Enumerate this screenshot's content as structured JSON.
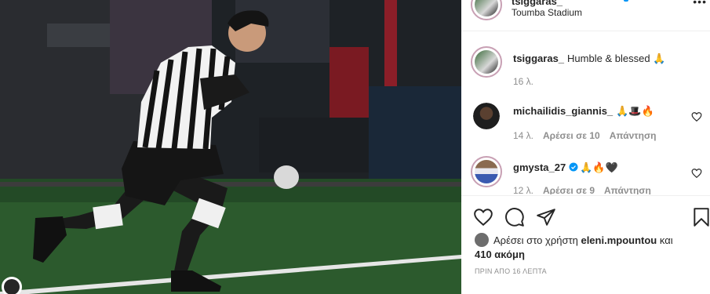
{
  "post_header": {
    "username": "tsiggaras_",
    "location": "Toumba Stadium",
    "more_label": "•••"
  },
  "comments": [
    {
      "username": "tsiggaras_",
      "text": "Humble & blessed 🙏",
      "time": "16 λ.",
      "likes": "",
      "reply": ""
    },
    {
      "username": "michailidis_giannis_",
      "text": "🙏🎩🔥",
      "time": "14 λ.",
      "likes": "Αρέσει σε 10",
      "reply": "Απάντηση"
    },
    {
      "username": "gmysta_27",
      "text": "🙏🔥🖤",
      "time": "12 λ.",
      "likes": "Αρέσει σε 9",
      "reply": "Απάντηση",
      "verified": true
    }
  ],
  "actions": {
    "icons": [
      "heart-icon",
      "comment-icon",
      "share-icon",
      "bookmark-icon"
    ]
  },
  "likes": {
    "prefix": "Αρέσει στο χρήστη",
    "user": "eleni.mpountou",
    "suffix": "και",
    "count": "410 ακόμη"
  },
  "timestamp": "ΠΡΙΝ ΑΠΟ 16 ΛΕΠΤΑ",
  "colors": {
    "accent_blue": "#0095f6",
    "text_gray": "#8e8e8e",
    "border": "#efefef"
  }
}
